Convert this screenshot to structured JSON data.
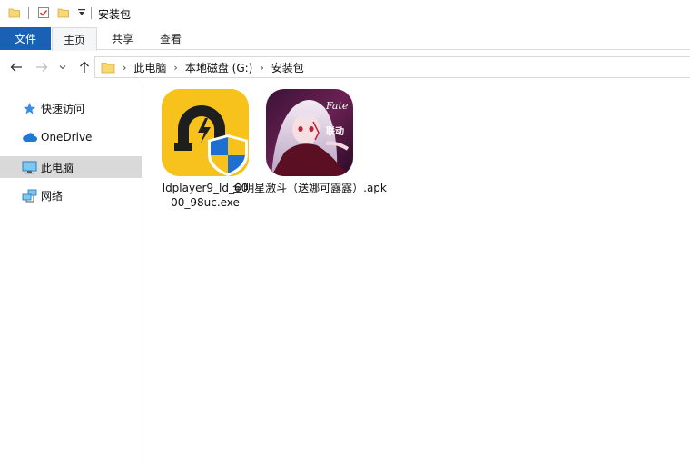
{
  "window": {
    "title": "安装包"
  },
  "quick_access_toolbar": {
    "icons": [
      "folder-icon",
      "properties-checkmark-icon",
      "new-folder-icon",
      "customize-dropdown-icon"
    ]
  },
  "ribbon": {
    "tabs": [
      {
        "label": "文件"
      },
      {
        "label": "主页"
      },
      {
        "label": "共享"
      },
      {
        "label": "查看"
      }
    ]
  },
  "address_bar": {
    "crumbs": [
      "此电脑",
      "本地磁盘 (G:)",
      "安装包"
    ]
  },
  "sidebar": {
    "items": [
      {
        "label": "快速访问",
        "icon": "star-icon"
      },
      {
        "label": "OneDrive",
        "icon": "cloud-icon"
      },
      {
        "label": "此电脑",
        "icon": "computer-icon",
        "selected": true
      },
      {
        "label": "网络",
        "icon": "network-icon"
      }
    ]
  },
  "files": [
    {
      "name": "ldplayer9_ld_6000_98uc.exe",
      "name_line1": "ldplayer9_ld_60",
      "name_line2": "00_98uc.exe",
      "icon": "ldplayer-shield-icon"
    },
    {
      "name": "全明星激斗（送娜可露露）.apk",
      "icon": "fate-anime-icon",
      "thumb_text_1": "Fate",
      "thumb_text_2": "联动"
    }
  ],
  "colors": {
    "file_tab_bg": "#1a61b6",
    "ldplayer_yellow": "#f7c21b",
    "selected_nav": "#d9d9d9"
  }
}
